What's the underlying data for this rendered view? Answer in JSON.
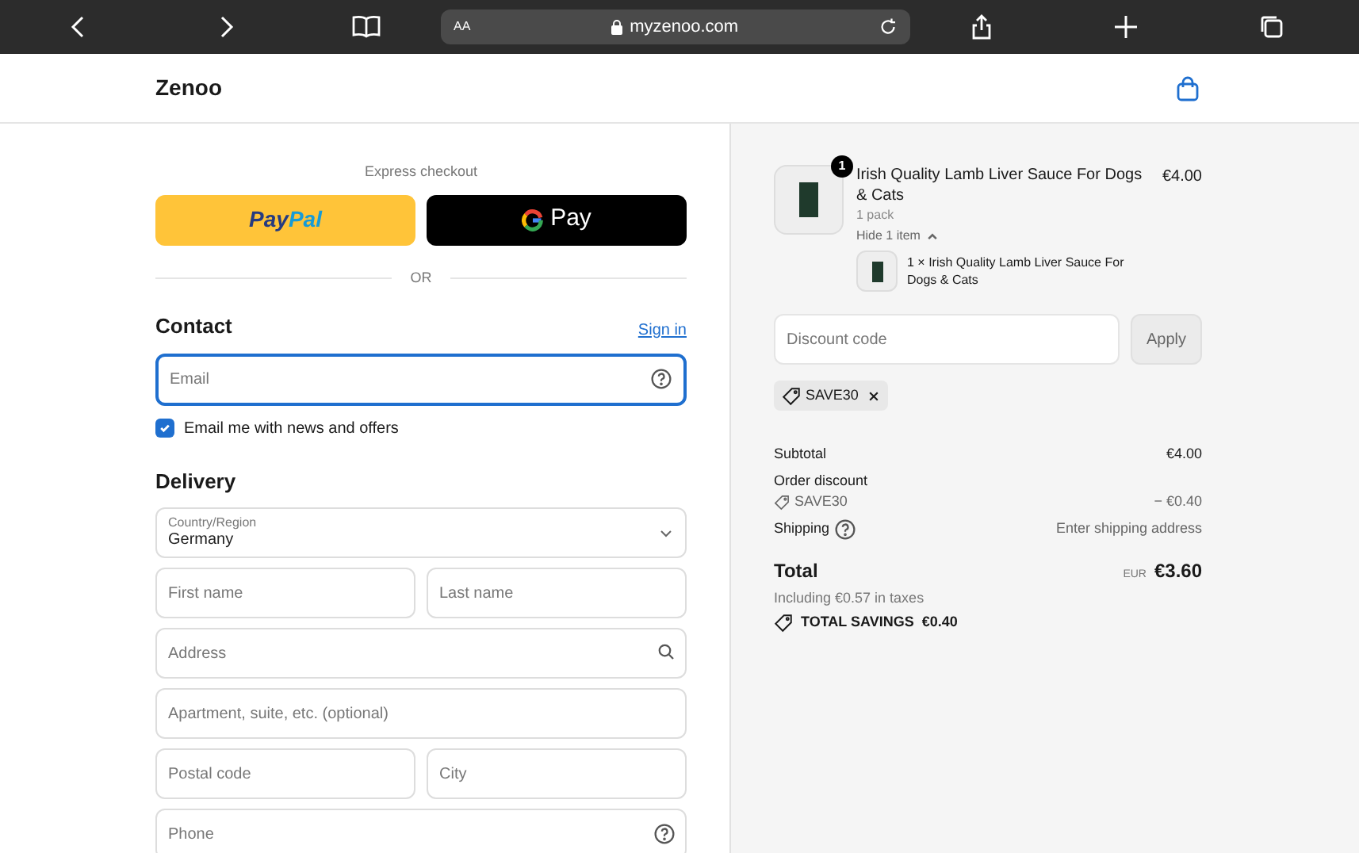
{
  "browser": {
    "text_size_label": "AA",
    "url": "myzenoo.com"
  },
  "header": {
    "store_name": "Zenoo"
  },
  "express_checkout": {
    "label": "Express checkout",
    "buttons": [
      {
        "kind": "paypal",
        "label_dark": "Pay",
        "label_light": "Pal"
      },
      {
        "kind": "gpay",
        "label": "Pay"
      }
    ],
    "divider": "OR"
  },
  "contact": {
    "title": "Contact",
    "sign_in": "Sign in",
    "email": {
      "placeholder": "Email",
      "focused": true
    },
    "newsletter": {
      "label": "Email me with news and offers",
      "checked": true
    }
  },
  "delivery": {
    "title": "Delivery",
    "fields": [
      {
        "kind": "select",
        "label": "Country/Region",
        "value": "Germany"
      },
      {
        "kind": "pair",
        "items": [
          {
            "placeholder": "First name"
          },
          {
            "placeholder": "Last name"
          }
        ]
      },
      {
        "kind": "search",
        "placeholder": "Address"
      },
      {
        "kind": "text",
        "placeholder": "Apartment, suite, etc. (optional)"
      },
      {
        "kind": "pair",
        "items": [
          {
            "placeholder": "Postal code"
          },
          {
            "placeholder": "City"
          }
        ]
      },
      {
        "kind": "help",
        "placeholder": "Phone"
      }
    ]
  },
  "order": {
    "item": {
      "quantity": "1",
      "title": "Irish Quality Lamb Liver Sauce For Dogs & Cats",
      "variant": "1 pack",
      "price": "€4.00",
      "toggle": "Hide 1 item",
      "expanded": true,
      "sub_items": [
        "1 × Irish Quality Lamb Liver Sauce For Dogs & Cats"
      ]
    },
    "discount": {
      "placeholder": "Discount code",
      "apply": "Apply",
      "applied_codes": [
        "SAVE30"
      ]
    },
    "summary": [
      {
        "kind": "plain",
        "label": "Subtotal",
        "value": "€4.00"
      },
      {
        "kind": "heading",
        "label": "Order discount"
      },
      {
        "kind": "code",
        "label": "SAVE30",
        "value": "− €0.40"
      },
      {
        "kind": "help",
        "label": "Shipping",
        "value": "Enter shipping address"
      }
    ],
    "total": {
      "label": "Total",
      "currency": "EUR",
      "value": "€3.60",
      "taxes": "Including €0.57 in taxes",
      "savings_label": "TOTAL SAVINGS",
      "savings_value": "€0.40"
    }
  }
}
